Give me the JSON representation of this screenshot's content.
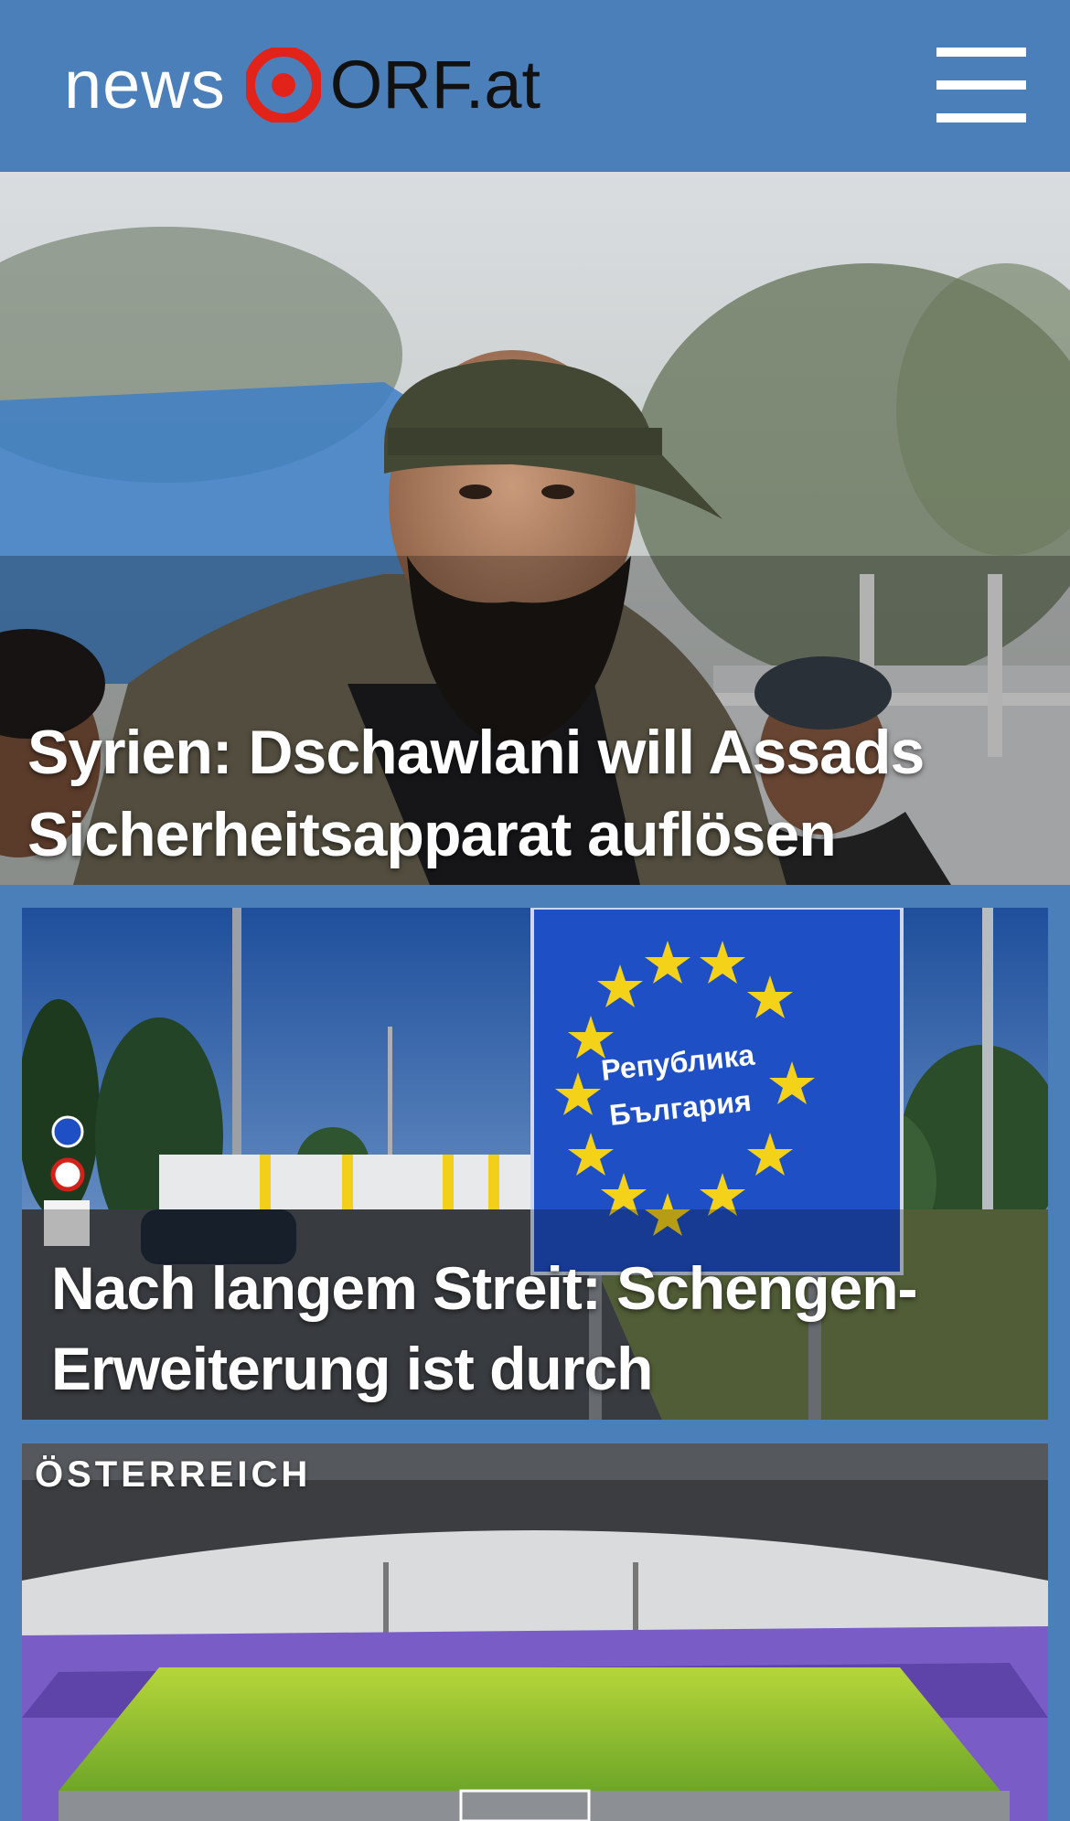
{
  "header": {
    "logo_news": "news",
    "logo_orf": "ORF.at",
    "menu_icon": "hamburger-menu-icon",
    "background_color": "#4b7fba"
  },
  "articles": [
    {
      "headline_line1": "Syrien: Dschawlani will Assads",
      "headline_line2": "Sicherheitsapparat auflösen"
    },
    {
      "headline_line1": "Nach langem Streit: Schengen-",
      "headline_line2": "Erweiterung ist durch",
      "sign_text_line1": "Република",
      "sign_text_line2": "България"
    },
    {
      "category": "ÖSTERREICH"
    }
  ],
  "colors": {
    "brand_blue": "#4b7fba",
    "logo_red": "#e2231a",
    "eu_blue": "#1f4fc4",
    "eu_star": "#f5d21a"
  }
}
